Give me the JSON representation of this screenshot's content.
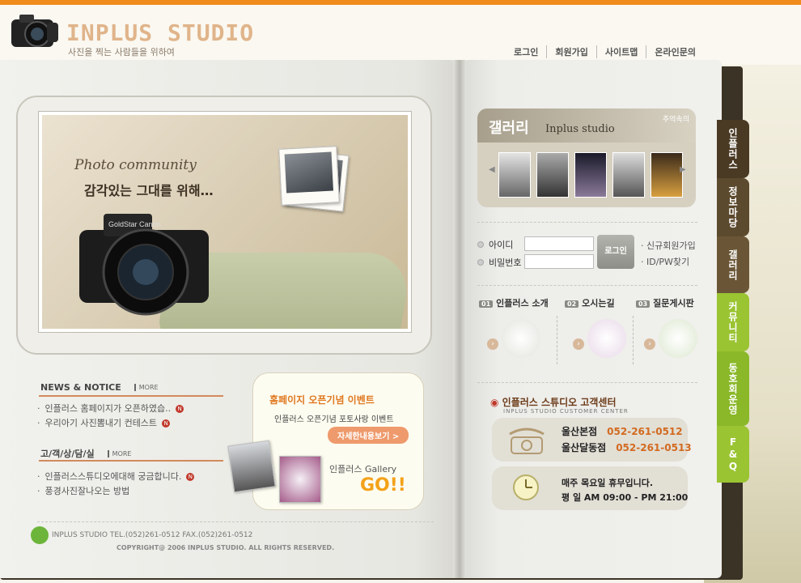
{
  "header": {
    "title": "INPLUS STUDIO",
    "subtitle": "사진을 찍는 사람들을 위하여",
    "nav": [
      "로그인",
      "회원가입",
      "사이트맵",
      "온라인문의"
    ]
  },
  "hero": {
    "photo_text": "Photo community",
    "slogan": "감각있는 그대를 위해…",
    "camera_brand": "GoldStar Canon"
  },
  "news": {
    "title": "NEWS & NOTICE",
    "more": "MORE",
    "items": [
      "인플러스 홈페이지가 오픈하였습..",
      "우리아기 사진뽐내기 컨테스트"
    ]
  },
  "consult": {
    "title": "고/객/상/담/실",
    "more": "MORE",
    "items": [
      "인플러스스튜디오에대해 궁금합니다.",
      "풍경사진잘나오는 방법"
    ]
  },
  "promo": {
    "title": "홈페이지 오픈기념 이벤트",
    "desc": "인플러스 오픈기념 포토사랑 이벤트",
    "button": "자세한내용보기 >",
    "gallery_label": "인플러스 Gallery",
    "go": "GO!!"
  },
  "footer": {
    "line": "INPLUS STUDIO  TEL.(052)261-0512  FAX.(052)261-0512",
    "copyright": "COPYRIGHT@ 2006 INPLUS STUDIO. ALL RIGHTS RESERVED."
  },
  "gallery": {
    "title": "갤러리",
    "sub": "Inplus studio",
    "badge": "추억속의"
  },
  "login": {
    "id_label": "아이디",
    "pw_label": "비밀번호",
    "button": "로그인",
    "links": [
      "신규회원가입",
      "ID/PW찾기"
    ]
  },
  "services": [
    {
      "num": "01",
      "label": "인플러스 소개"
    },
    {
      "num": "02",
      "label": "오시는길"
    },
    {
      "num": "03",
      "label": "질문게시판"
    }
  ],
  "customer_center": {
    "title": "인플러스 스튜디오 고객센터",
    "sub": "INPLUS STUDIO CUSTOMER CENTER",
    "branches": [
      {
        "name": "울산본점",
        "phone": "052-261-0512"
      },
      {
        "name": "울산달동점",
        "phone": "052-261-0513"
      }
    ],
    "holiday": "매주 목요일 휴무입니다.",
    "holiday_highlight": "목요일",
    "hours": "평   일 AM 09:00 - PM 21:00"
  },
  "tabs": [
    {
      "label": "인플러스",
      "color": "#4a3a24"
    },
    {
      "label": "정보마당",
      "color": "#5c4a2e"
    },
    {
      "label": "갤러리",
      "color": "#6a5636"
    },
    {
      "label": "커뮤니티",
      "color": "#9ac432"
    },
    {
      "label": "동호회운영",
      "color": "#8ab828"
    },
    {
      "label": "F&Q",
      "color": "#9ac432"
    }
  ],
  "colors": {
    "accent": "#f08c1c",
    "news_rule": "#d38a5c",
    "phone": "#d26a20"
  }
}
